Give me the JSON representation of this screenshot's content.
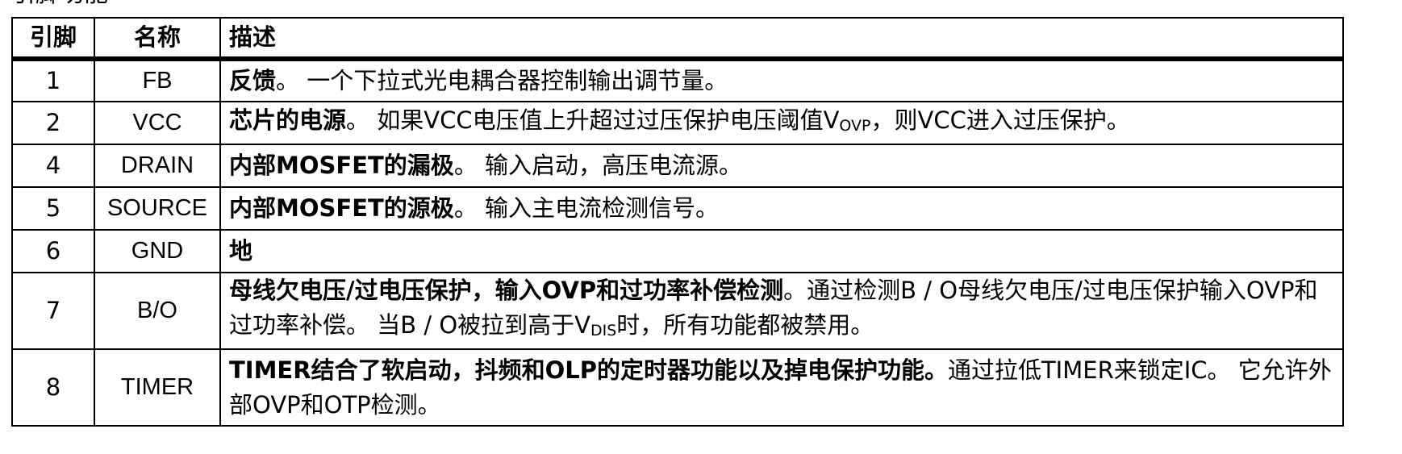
{
  "section_title": "引脚功能",
  "table": {
    "headers": {
      "pin": "引脚",
      "name": "名称",
      "desc": "描述"
    },
    "rows": [
      {
        "pin": "1",
        "name": "FB",
        "desc_bold": "反馈",
        "desc_rest": "。 一个下拉式光电耦合器控制输出调节量。"
      },
      {
        "pin": "2",
        "name": "VCC",
        "desc_bold": "芯片的电源",
        "desc_a": "。 如果VCC电压值上升超过过压保护电压阈值V",
        "desc_sub": "OVP",
        "desc_b": "，则VCC进入过压保护。"
      },
      {
        "pin": "4",
        "name": "DRAIN",
        "desc_bold": "内部MOSFET的漏极",
        "desc_rest": "。 输入启动，高压电流源。"
      },
      {
        "pin": "5",
        "name": "SOURCE",
        "desc_bold": "内部MOSFET的源极",
        "desc_rest": "。 输入主电流检测信号。"
      },
      {
        "pin": "6",
        "name": "GND",
        "desc_bold": "地",
        "desc_rest": ""
      },
      {
        "pin": "7",
        "name": "B/O",
        "desc_bold": "母线欠电压/过电压保护，输入OVP和过功率补偿检测",
        "desc_a": "。通过检测B / O母线欠电压/过电压保护输入OVP和过功率补偿。 当B / O被拉到高于V",
        "desc_sub": "DIS",
        "desc_b": "时，所有功能都被禁用。"
      },
      {
        "pin": "8",
        "name": "TIMER",
        "desc_bold": "TIMER结合了软启动，抖频和OLP的定时器功能以及掉电保护功能。",
        "desc_rest": "通过拉低TIMER来锁定IC。 它允许外部OVP和OTP检测。"
      }
    ]
  }
}
